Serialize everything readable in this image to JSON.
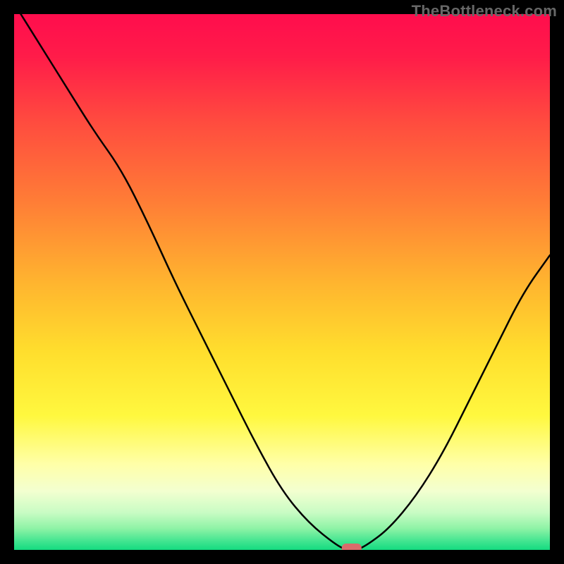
{
  "watermark": "TheBottleneck.com",
  "chart_data": {
    "type": "line",
    "title": "",
    "xlabel": "",
    "ylabel": "",
    "xlim": [
      0,
      100
    ],
    "ylim": [
      0,
      100
    ],
    "x": [
      0,
      5,
      10,
      15,
      20,
      25,
      30,
      35,
      40,
      45,
      50,
      55,
      60,
      62,
      64,
      66,
      70,
      75,
      80,
      85,
      90,
      95,
      100
    ],
    "values": [
      102,
      94,
      86,
      78,
      71,
      61,
      50,
      40,
      30,
      20,
      11,
      5,
      1,
      0,
      0,
      1,
      4,
      10,
      18,
      28,
      38,
      48,
      55
    ],
    "marker": {
      "x": 63,
      "y": 0
    },
    "gradient_stops": [
      {
        "offset": 0.0,
        "color": "#ff0d4d"
      },
      {
        "offset": 0.08,
        "color": "#ff1c49"
      },
      {
        "offset": 0.2,
        "color": "#ff4b3f"
      },
      {
        "offset": 0.35,
        "color": "#ff7d36"
      },
      {
        "offset": 0.5,
        "color": "#ffb42f"
      },
      {
        "offset": 0.63,
        "color": "#ffde2d"
      },
      {
        "offset": 0.75,
        "color": "#fff83f"
      },
      {
        "offset": 0.84,
        "color": "#ffffa8"
      },
      {
        "offset": 0.89,
        "color": "#f3ffd0"
      },
      {
        "offset": 0.93,
        "color": "#c9fcc4"
      },
      {
        "offset": 0.96,
        "color": "#8ef3a6"
      },
      {
        "offset": 0.985,
        "color": "#3ee48f"
      },
      {
        "offset": 1.0,
        "color": "#14db80"
      }
    ]
  }
}
